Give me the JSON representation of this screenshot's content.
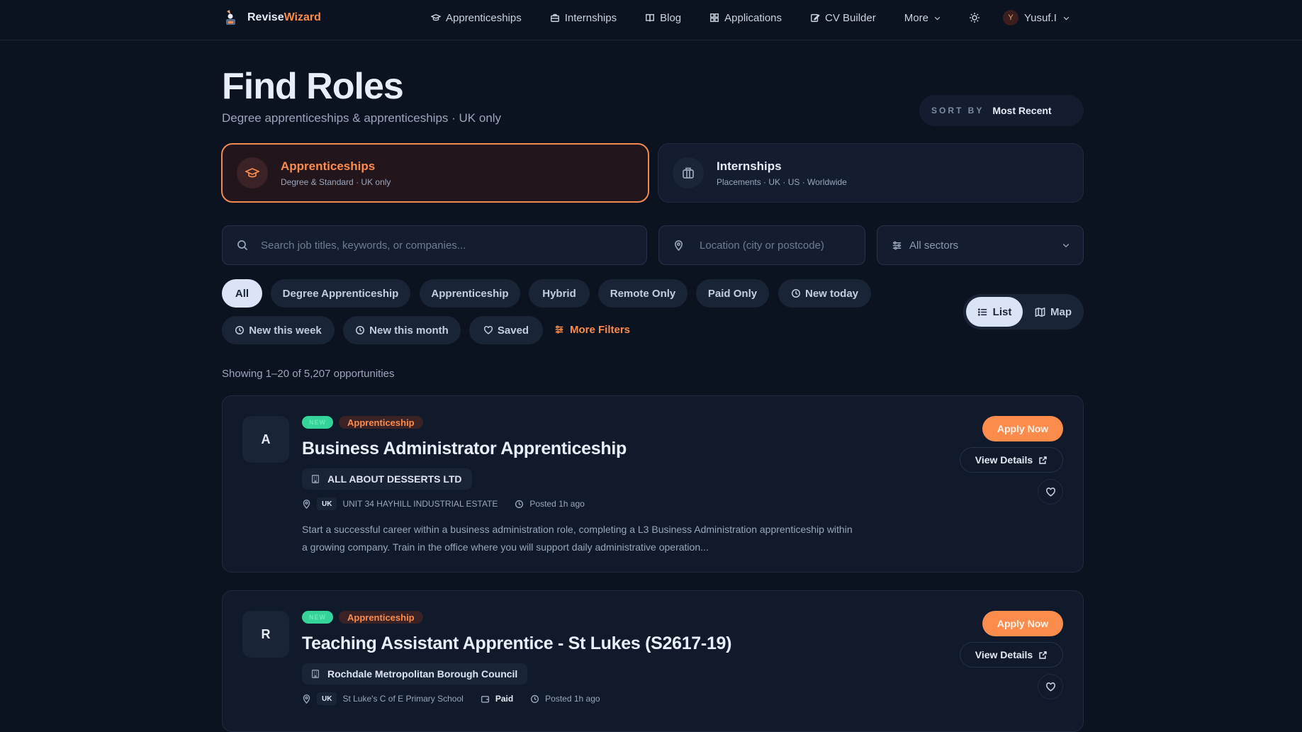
{
  "brand": {
    "name_part1": "Revise",
    "name_part2": "Wizard"
  },
  "nav": {
    "links": [
      {
        "label": "Apprenticeships",
        "icon": "graduation-cap-icon"
      },
      {
        "label": "Internships",
        "icon": "briefcase-icon"
      },
      {
        "label": "Blog",
        "icon": "book-icon"
      },
      {
        "label": "Applications",
        "icon": "grid-icon"
      },
      {
        "label": "CV Builder",
        "icon": "edit-icon"
      },
      {
        "label": "More",
        "icon": "chevron-down-icon"
      }
    ],
    "theme_icon": "sun-icon",
    "user": {
      "initial": "Y",
      "name": "Yusuf.I"
    }
  },
  "header": {
    "title": "Find Roles",
    "subtitle": "Degree apprenticeships & apprenticeships · UK only",
    "sort": {
      "label": "SORT BY",
      "value": "Most Recent"
    }
  },
  "type_cards": [
    {
      "title": "Apprenticeships",
      "subtitle": "Degree & Standard · UK only",
      "active": true
    },
    {
      "title": "Internships",
      "subtitle": "Placements · UK · US · Worldwide",
      "active": false
    }
  ],
  "search": {
    "query_placeholder": "Search job titles, keywords, or companies...",
    "location_placeholder": "Location (city or postcode)",
    "sector_value": "All sectors"
  },
  "filters": {
    "chips": [
      "All",
      "Degree Apprenticeship",
      "Apprenticeship",
      "Hybrid",
      "Remote Only",
      "Paid Only",
      "New today",
      "New this week",
      "New this month",
      "Saved"
    ],
    "more_filters": "More Filters",
    "selected": "All"
  },
  "view_toggle": {
    "list": "List",
    "map": "Map",
    "selected": "List"
  },
  "results": {
    "count_text": "Showing 1–20 of 5,207 opportunities"
  },
  "listings": [
    {
      "initial": "A",
      "badge_new": "NEW",
      "badge_type": "Apprenticeship",
      "title": "Business Administrator Apprenticeship",
      "company": "ALL ABOUT DESSERTS LTD",
      "country": "UK",
      "location": "UNIT 34 HAYHILL INDUSTRIAL ESTATE",
      "posted": "Posted 1h ago",
      "description": "Start a successful career within a business administration role, completing a L3 Business Administration apprenticeship within a growing company. Train in the office where you will support daily administrative operation...",
      "apply_label": "Apply Now",
      "details_label": "View Details"
    },
    {
      "initial": "R",
      "badge_new": "NEW",
      "badge_type": "Apprenticeship",
      "title": "Teaching Assistant Apprentice - St Lukes (S2617-19)",
      "company": "Rochdale Metropolitan Borough Council",
      "country": "UK",
      "location": "St Luke's C of E Primary School",
      "paid": "Paid",
      "posted": "Posted 1h ago",
      "apply_label": "Apply Now",
      "details_label": "View Details"
    }
  ],
  "colors": {
    "accent": "#fb8c4c",
    "background": "#0b1220",
    "card": "#141d30",
    "new_badge": "#34d399"
  }
}
